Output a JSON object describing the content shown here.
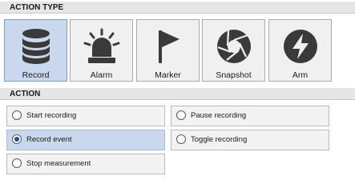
{
  "sections": {
    "action_type": "ACTION TYPE",
    "action": "ACTION"
  },
  "action_types": [
    {
      "label": "Record",
      "icon": "database-icon",
      "selected": true
    },
    {
      "label": "Alarm",
      "icon": "siren-icon",
      "selected": false
    },
    {
      "label": "Marker",
      "icon": "flag-icon",
      "selected": false
    },
    {
      "label": "Snapshot",
      "icon": "aperture-icon",
      "selected": false
    },
    {
      "label": "Arm",
      "icon": "lightning-icon",
      "selected": false
    }
  ],
  "actions": [
    {
      "label": "Start recording",
      "selected": false
    },
    {
      "label": "Pause recording",
      "selected": false
    },
    {
      "label": "Record event",
      "selected": true
    },
    {
      "label": "Toggle recording",
      "selected": false
    },
    {
      "label": "Stop measurement",
      "selected": false
    }
  ],
  "colors": {
    "selected_bg": "#c9d8ec",
    "icon": "#3a3a3a",
    "radio_dot": "#1f4e92"
  }
}
